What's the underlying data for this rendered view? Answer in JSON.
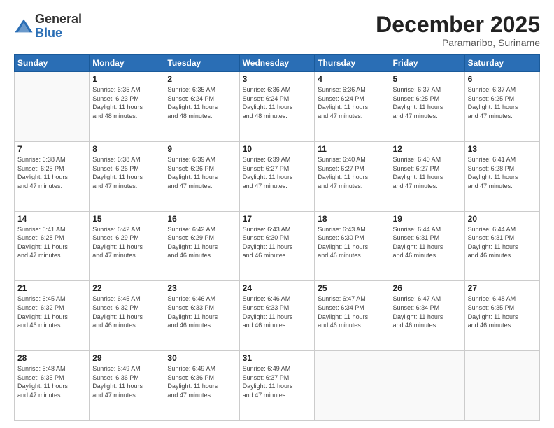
{
  "logo": {
    "general": "General",
    "blue": "Blue"
  },
  "title": "December 2025",
  "subtitle": "Paramaribo, Suriname",
  "headers": [
    "Sunday",
    "Monday",
    "Tuesday",
    "Wednesday",
    "Thursday",
    "Friday",
    "Saturday"
  ],
  "weeks": [
    [
      {
        "day": "",
        "info": ""
      },
      {
        "day": "1",
        "info": "Sunrise: 6:35 AM\nSunset: 6:23 PM\nDaylight: 11 hours\nand 48 minutes."
      },
      {
        "day": "2",
        "info": "Sunrise: 6:35 AM\nSunset: 6:24 PM\nDaylight: 11 hours\nand 48 minutes."
      },
      {
        "day": "3",
        "info": "Sunrise: 6:36 AM\nSunset: 6:24 PM\nDaylight: 11 hours\nand 48 minutes."
      },
      {
        "day": "4",
        "info": "Sunrise: 6:36 AM\nSunset: 6:24 PM\nDaylight: 11 hours\nand 47 minutes."
      },
      {
        "day": "5",
        "info": "Sunrise: 6:37 AM\nSunset: 6:25 PM\nDaylight: 11 hours\nand 47 minutes."
      },
      {
        "day": "6",
        "info": "Sunrise: 6:37 AM\nSunset: 6:25 PM\nDaylight: 11 hours\nand 47 minutes."
      }
    ],
    [
      {
        "day": "7",
        "info": "Sunrise: 6:38 AM\nSunset: 6:25 PM\nDaylight: 11 hours\nand 47 minutes."
      },
      {
        "day": "8",
        "info": "Sunrise: 6:38 AM\nSunset: 6:26 PM\nDaylight: 11 hours\nand 47 minutes."
      },
      {
        "day": "9",
        "info": "Sunrise: 6:39 AM\nSunset: 6:26 PM\nDaylight: 11 hours\nand 47 minutes."
      },
      {
        "day": "10",
        "info": "Sunrise: 6:39 AM\nSunset: 6:27 PM\nDaylight: 11 hours\nand 47 minutes."
      },
      {
        "day": "11",
        "info": "Sunrise: 6:40 AM\nSunset: 6:27 PM\nDaylight: 11 hours\nand 47 minutes."
      },
      {
        "day": "12",
        "info": "Sunrise: 6:40 AM\nSunset: 6:27 PM\nDaylight: 11 hours\nand 47 minutes."
      },
      {
        "day": "13",
        "info": "Sunrise: 6:41 AM\nSunset: 6:28 PM\nDaylight: 11 hours\nand 47 minutes."
      }
    ],
    [
      {
        "day": "14",
        "info": "Sunrise: 6:41 AM\nSunset: 6:28 PM\nDaylight: 11 hours\nand 47 minutes."
      },
      {
        "day": "15",
        "info": "Sunrise: 6:42 AM\nSunset: 6:29 PM\nDaylight: 11 hours\nand 47 minutes."
      },
      {
        "day": "16",
        "info": "Sunrise: 6:42 AM\nSunset: 6:29 PM\nDaylight: 11 hours\nand 46 minutes."
      },
      {
        "day": "17",
        "info": "Sunrise: 6:43 AM\nSunset: 6:30 PM\nDaylight: 11 hours\nand 46 minutes."
      },
      {
        "day": "18",
        "info": "Sunrise: 6:43 AM\nSunset: 6:30 PM\nDaylight: 11 hours\nand 46 minutes."
      },
      {
        "day": "19",
        "info": "Sunrise: 6:44 AM\nSunset: 6:31 PM\nDaylight: 11 hours\nand 46 minutes."
      },
      {
        "day": "20",
        "info": "Sunrise: 6:44 AM\nSunset: 6:31 PM\nDaylight: 11 hours\nand 46 minutes."
      }
    ],
    [
      {
        "day": "21",
        "info": "Sunrise: 6:45 AM\nSunset: 6:32 PM\nDaylight: 11 hours\nand 46 minutes."
      },
      {
        "day": "22",
        "info": "Sunrise: 6:45 AM\nSunset: 6:32 PM\nDaylight: 11 hours\nand 46 minutes."
      },
      {
        "day": "23",
        "info": "Sunrise: 6:46 AM\nSunset: 6:33 PM\nDaylight: 11 hours\nand 46 minutes."
      },
      {
        "day": "24",
        "info": "Sunrise: 6:46 AM\nSunset: 6:33 PM\nDaylight: 11 hours\nand 46 minutes."
      },
      {
        "day": "25",
        "info": "Sunrise: 6:47 AM\nSunset: 6:34 PM\nDaylight: 11 hours\nand 46 minutes."
      },
      {
        "day": "26",
        "info": "Sunrise: 6:47 AM\nSunset: 6:34 PM\nDaylight: 11 hours\nand 46 minutes."
      },
      {
        "day": "27",
        "info": "Sunrise: 6:48 AM\nSunset: 6:35 PM\nDaylight: 11 hours\nand 46 minutes."
      }
    ],
    [
      {
        "day": "28",
        "info": "Sunrise: 6:48 AM\nSunset: 6:35 PM\nDaylight: 11 hours\nand 47 minutes."
      },
      {
        "day": "29",
        "info": "Sunrise: 6:49 AM\nSunset: 6:36 PM\nDaylight: 11 hours\nand 47 minutes."
      },
      {
        "day": "30",
        "info": "Sunrise: 6:49 AM\nSunset: 6:36 PM\nDaylight: 11 hours\nand 47 minutes."
      },
      {
        "day": "31",
        "info": "Sunrise: 6:49 AM\nSunset: 6:37 PM\nDaylight: 11 hours\nand 47 minutes."
      },
      {
        "day": "",
        "info": ""
      },
      {
        "day": "",
        "info": ""
      },
      {
        "day": "",
        "info": ""
      }
    ]
  ]
}
